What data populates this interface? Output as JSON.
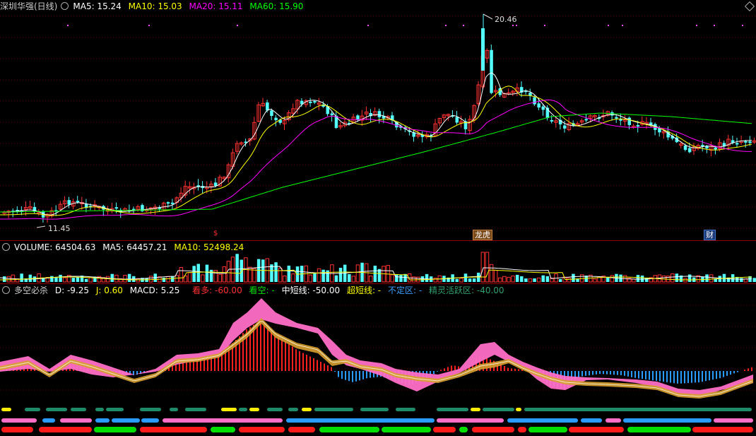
{
  "price_panel": {
    "title": "深圳华强(日线)",
    "ma5_label": "MA5: 15.24",
    "ma10_label": "MA10: 15.03",
    "ma20_label": "MA20: 15.11",
    "ma60_label": "MA60: 15.90",
    "high_label": "20.46",
    "low_label": "11.45",
    "markers": [
      "$",
      "龙虎",
      "财"
    ],
    "colors": {
      "ma5": "#ffffff",
      "ma10": "#ffff00",
      "ma20": "#ff00ff",
      "ma60": "#00ff00",
      "up": "#ff3232",
      "down": "#54ffff"
    }
  },
  "volume_panel": {
    "volume_label": "VOLUME: 64504.63",
    "ma5_label": "MA5: 64457.21",
    "ma10_label": "MA10: 52498.24"
  },
  "indicator_panel": {
    "title": "多空必杀",
    "d_label": "D: -9.25",
    "j_label": "J: 0.60",
    "macd_label": "MACD: 5.25",
    "bull_label": "看多: -60.00",
    "bear_label": "看空: -",
    "mid_label": "中短线: -50.00",
    "super_label": "超短线: -",
    "uncertain_label": "不定区: -",
    "active_label": "精灵活跃区: -40.00"
  },
  "corner_icon": "diamond-icon"
}
